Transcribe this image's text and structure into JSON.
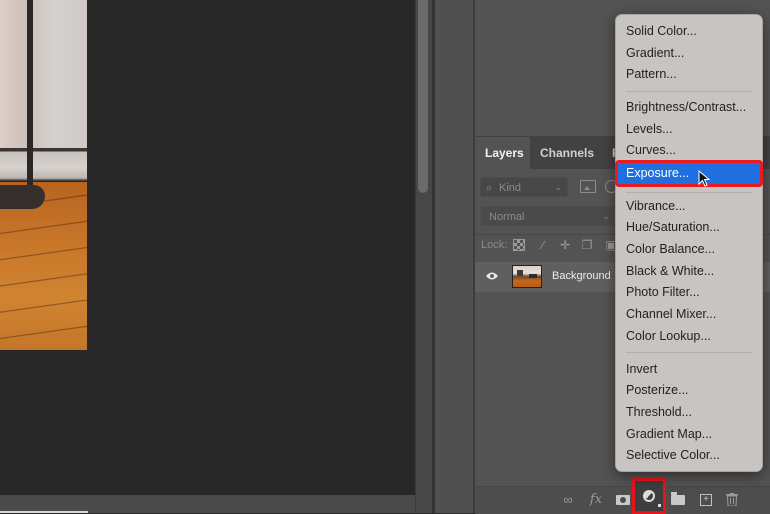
{
  "canvas": {
    "image_description": "Room interior photo: white wall, baseboard, black floor lamp, orange hardwood floor"
  },
  "layers_panel": {
    "tabs": [
      {
        "label": "Layers",
        "active": true
      },
      {
        "label": "Channels",
        "active": false
      },
      {
        "label": "Pa",
        "active": false
      }
    ],
    "filter": {
      "placeholder": "Kind",
      "icons": [
        "search-icon",
        "image-filter-icon",
        "adjustment-filter-icon"
      ]
    },
    "blend_mode": "Normal",
    "lock_label": "Lock:",
    "lock_icons": [
      "lock-transparent-pixels-icon",
      "lock-image-pixels-icon",
      "lock-position-icon",
      "lock-artboard-icon",
      "lock-all-icon"
    ],
    "layers": [
      {
        "name": "Background",
        "visible": true
      }
    ],
    "footer_icons": [
      "link-layers-icon",
      "fx-icon",
      "add-mask-icon",
      "new-adjustment-layer-icon",
      "new-group-icon",
      "new-layer-icon",
      "delete-layer-icon"
    ],
    "footer_fx_label": "fx"
  },
  "adjustment_menu": {
    "highlight_color": "#1f6fe0",
    "annotation_color": "#e8141c",
    "groups": [
      [
        "Solid Color...",
        "Gradient...",
        "Pattern..."
      ],
      [
        "Brightness/Contrast...",
        "Levels...",
        "Curves...",
        "Exposure..."
      ],
      [
        "Vibrance...",
        "Hue/Saturation...",
        "Color Balance...",
        "Black & White...",
        "Photo Filter...",
        "Channel Mixer...",
        "Color Lookup..."
      ],
      [
        "Invert",
        "Posterize...",
        "Threshold...",
        "Gradient Map...",
        "Selective Color..."
      ]
    ],
    "highlighted_item": "Exposure..."
  }
}
